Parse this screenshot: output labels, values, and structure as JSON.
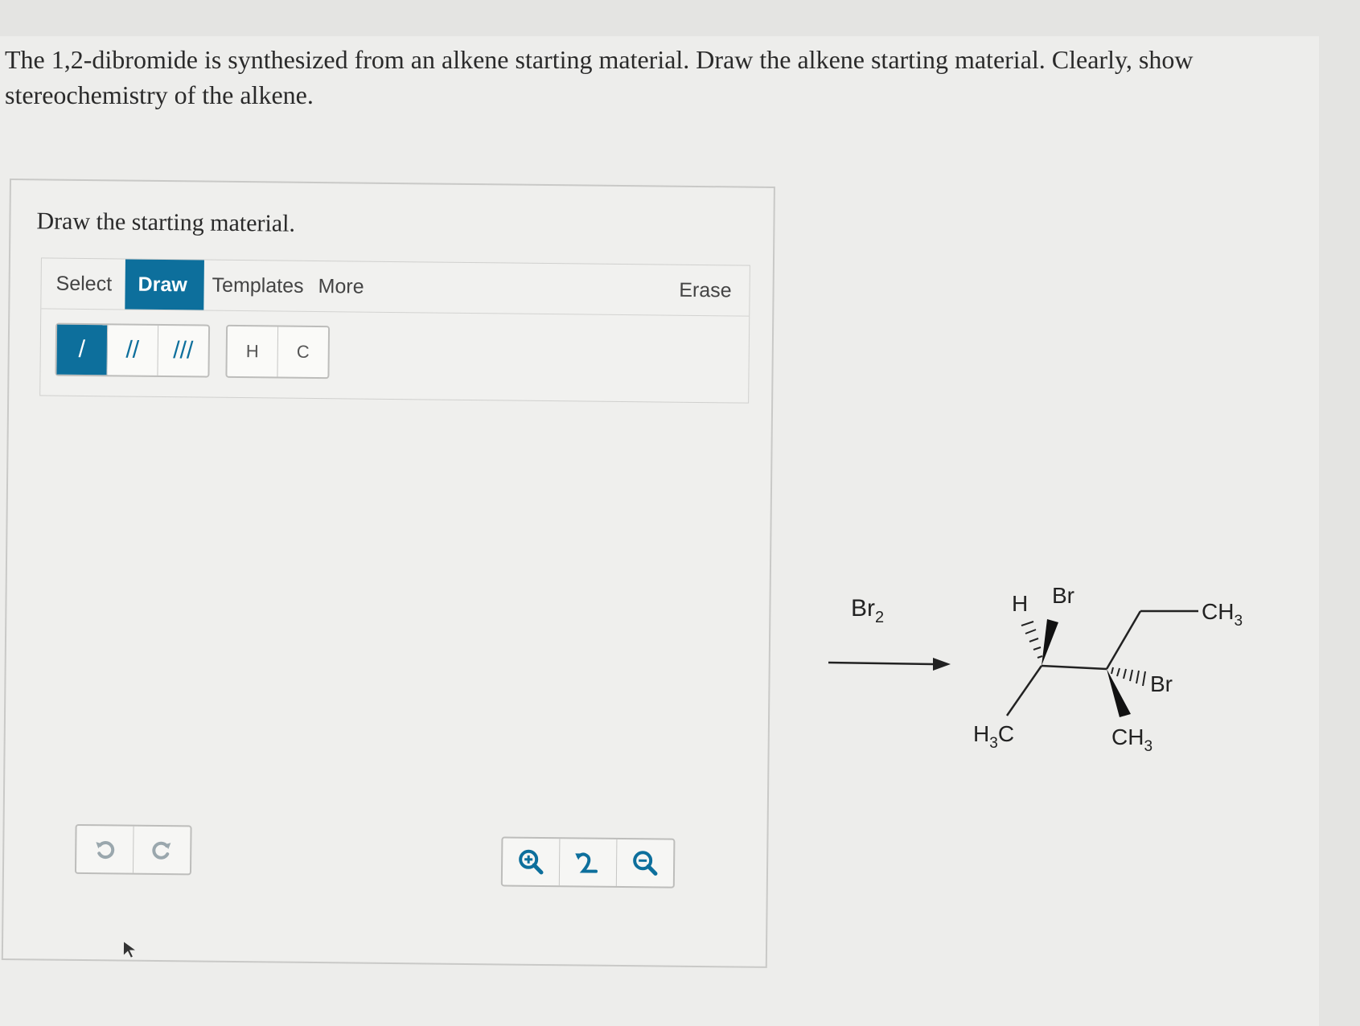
{
  "question": {
    "text": "The 1,2-dibromide is synthesized from an alkene starting material. Draw the alkene starting material. Clearly, show stereochemistry of the alkene."
  },
  "panel": {
    "title": "Draw the starting material."
  },
  "toolbar": {
    "tabs": [
      {
        "label": "Select",
        "active": false
      },
      {
        "label": "Draw",
        "active": true
      },
      {
        "label": "Templates",
        "active": false
      },
      {
        "label": "More",
        "active": false
      }
    ],
    "erase_label": "Erase",
    "bond_tools": [
      {
        "icon": "single-bond-icon",
        "glyph": "/",
        "active": true
      },
      {
        "icon": "double-bond-icon",
        "glyph": "//",
        "active": false
      },
      {
        "icon": "triple-bond-icon",
        "glyph": "///",
        "active": false
      }
    ],
    "atom_tools": [
      "H",
      "C"
    ]
  },
  "canvas_controls": {
    "undo_icon": "undo-icon",
    "redo_icon": "redo-icon",
    "zoom_in_icon": "zoom-in-icon",
    "reset_icon": "reset-zoom-icon",
    "zoom_out_icon": "zoom-out-icon"
  },
  "reaction": {
    "reagent": "Br",
    "reagent_sub": "2",
    "labels": {
      "h": "H",
      "br_top": "Br",
      "ch3_right": "CH",
      "ch3_right_sub": "3",
      "br_bottom": "Br",
      "h3c_left_pre": "H",
      "h3c_left_sub": "3",
      "h3c_left_post": "C",
      "ch3_bottom": "CH",
      "ch3_bottom_sub": "3"
    }
  },
  "colors": {
    "accent": "#0d6f9c"
  }
}
